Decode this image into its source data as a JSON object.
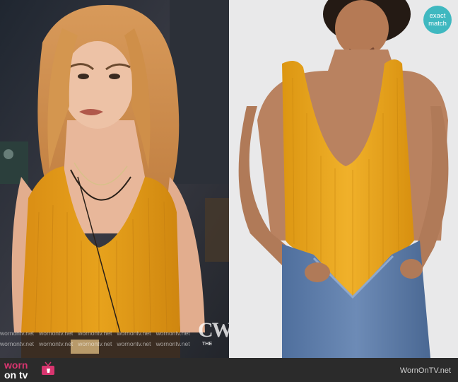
{
  "images": {
    "left_scene": "tv-still-woman-yellow-bodysuit",
    "right_product": "yellow-ribbed-bodysuit-product-shot"
  },
  "overlay": {
    "network_logo": "CW",
    "network_logo_small": "THE",
    "watermark_text": "wornontv.net"
  },
  "badge": {
    "line1": "exact",
    "line2": "match",
    "color": "#3fb8c0"
  },
  "footer": {
    "brand_line1": "worn",
    "brand_line2_on": "on",
    "brand_line2_tv": "tv",
    "site_name": "WornOnTV.net",
    "brand_color": "#d8356f",
    "background": "#2b2b2b"
  },
  "colors": {
    "bodysuit": "#e7a21c",
    "jeans": "#5b7ba8"
  }
}
